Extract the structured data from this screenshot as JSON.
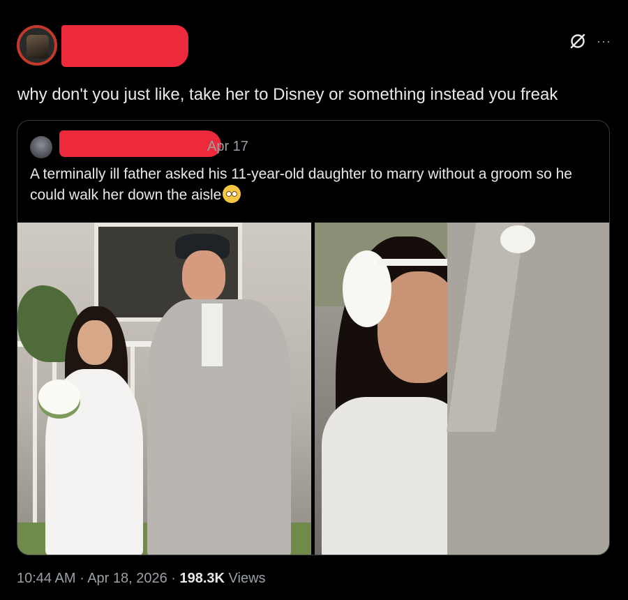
{
  "author": {
    "avatar_icon": "profile-avatar"
  },
  "header": {
    "grok_icon": "slashed-circle-icon",
    "more_icon": "ellipsis-icon",
    "more_label": "···"
  },
  "post": {
    "text": "why don't you just like, take her to Disney or something instead you freak"
  },
  "quoted_post": {
    "date": "Apr 17",
    "text": "A terminally ill father asked his 11-year-old daughter to marry without a groom so he could walk her down the aisle",
    "emoji": "smiling-face-with-tear"
  },
  "images": [
    {
      "label": "father walking daughter in white dress down aisle"
    },
    {
      "label": "close-up of crying girl with white flower in hair beside man in grey suit"
    }
  ],
  "footer": {
    "time": "10:44 AM",
    "separator": " · ",
    "date": "Apr 18, 2026",
    "views_count": "198.3K",
    "views_label": " Views"
  },
  "colors": {
    "background": "#000000",
    "text": "#e7e9ea",
    "muted": "#9aa0a6",
    "redaction": "#ec2a3b",
    "border": "#3a3d40"
  }
}
